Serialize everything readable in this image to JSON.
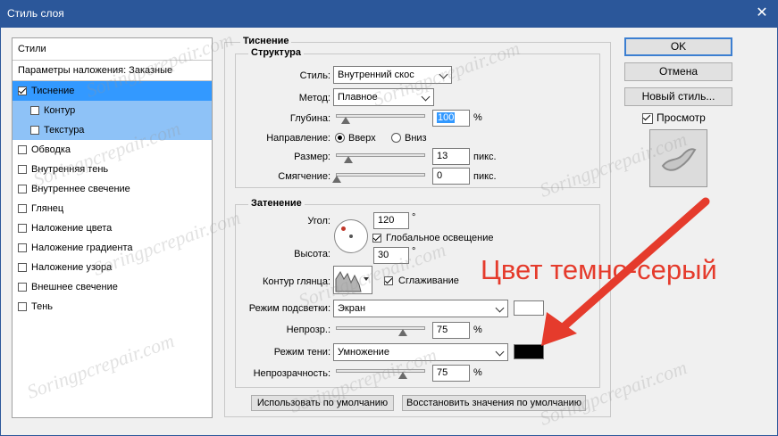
{
  "window": {
    "title": "Стиль слоя"
  },
  "styles_panel": {
    "header": "Стили",
    "blend_options": "Параметры наложения: Заказные",
    "items": [
      {
        "label": "Тиснение",
        "checked": true
      },
      {
        "label": "Контур",
        "checked": false
      },
      {
        "label": "Текстура",
        "checked": false
      },
      {
        "label": "Обводка",
        "checked": false
      },
      {
        "label": "Внутренняя тень",
        "checked": false
      },
      {
        "label": "Внутреннее свечение",
        "checked": false
      },
      {
        "label": "Глянец",
        "checked": false
      },
      {
        "label": "Наложение цвета",
        "checked": false
      },
      {
        "label": "Наложение градиента",
        "checked": false
      },
      {
        "label": "Наложение узора",
        "checked": false
      },
      {
        "label": "Внешнее свечение",
        "checked": false
      },
      {
        "label": "Тень",
        "checked": false
      }
    ]
  },
  "bevel": {
    "section_title": "Тиснение",
    "structure": {
      "title": "Структура",
      "style_label": "Стиль:",
      "style_value": "Внутренний скос",
      "technique_label": "Метод:",
      "technique_value": "Плавное",
      "depth_label": "Глубина:",
      "depth_value": "100",
      "depth_unit": "%",
      "direction_label": "Направление:",
      "direction_up": "Вверх",
      "direction_down": "Вниз",
      "size_label": "Размер:",
      "size_value": "13",
      "size_unit": "пикс.",
      "soften_label": "Смягчение:",
      "soften_value": "0",
      "soften_unit": "пикс."
    },
    "shading": {
      "title": "Затенение",
      "angle_label": "Угол:",
      "angle_value": "120",
      "degree": "°",
      "global_light": "Глобальное освещение",
      "global_light_checked": true,
      "altitude_label": "Высота:",
      "altitude_value": "30",
      "gloss_label": "Контур глянца:",
      "antialias": "Сглаживание",
      "antialias_checked": true,
      "highlight_mode_label": "Режим подсветки:",
      "highlight_mode_value": "Экран",
      "highlight_color": "#ffffff",
      "highlight_opacity_label": "Непрозр.:",
      "highlight_opacity_value": "75",
      "shadow_mode_label": "Режим тени:",
      "shadow_mode_value": "Умножение",
      "shadow_color": "#000000",
      "shadow_opacity_label": "Непрозрачность:",
      "shadow_opacity_value": "75",
      "percent": "%"
    },
    "levels": {
      "depth": 0.1,
      "size": 0.13,
      "soften": 0,
      "highlight_opacity": 0.75,
      "shadow_opacity": 0.75
    }
  },
  "buttons": {
    "ok": "OK",
    "cancel": "Отмена",
    "new_style": "Новый стиль...",
    "preview": "Просмотр",
    "make_default": "Использовать по умолчанию",
    "reset_default": "Восстановить значения по умолчанию"
  },
  "annotation": {
    "text": "Цвет темно-серый",
    "color": "#e53b2c"
  },
  "watermark": "Soringpcrepair.com"
}
